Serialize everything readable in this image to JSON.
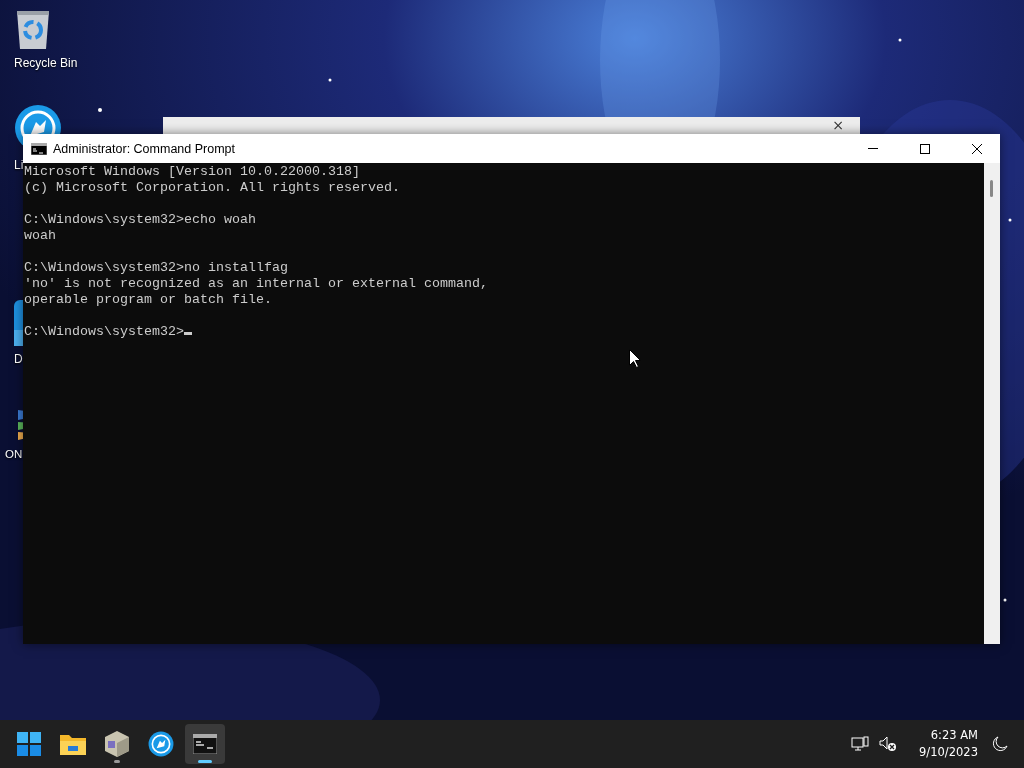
{
  "desktop_icons": [
    {
      "label": "Recycle Bin",
      "kind": "bin"
    },
    {
      "label": "Li",
      "kind": "wolf"
    },
    {
      "label": "D",
      "kind": "blue"
    },
    {
      "label": "ON",
      "kind": "multi"
    }
  ],
  "background_window": {
    "close": "×"
  },
  "window": {
    "title": "Administrator: Command Prompt",
    "console": {
      "cursor_visible": true,
      "blocks": [
        [
          "Microsoft Windows [Version 10.0.22000.318]",
          "(c) Microsoft Corporation. All rights reserved."
        ],
        [
          "C:\\Windows\\system32>echo woah",
          "woah"
        ],
        [
          "C:\\Windows\\system32>no installfag",
          "'no' is not recognized as an internal or external command,",
          "operable program or batch file."
        ],
        [
          "C:\\Windows\\system32>"
        ]
      ]
    }
  },
  "taskbar": {
    "apps": [
      {
        "kind": "start",
        "running": false,
        "selected": false
      },
      {
        "kind": "folder",
        "running": false,
        "selected": false
      },
      {
        "kind": "cube",
        "running": true,
        "selected": false
      },
      {
        "kind": "wolf",
        "running": false,
        "selected": false
      },
      {
        "kind": "terminal",
        "running": true,
        "selected": true
      }
    ],
    "tray": {
      "time": "6:23 AM",
      "date": "9/10/2023",
      "sound_muted": true
    }
  }
}
